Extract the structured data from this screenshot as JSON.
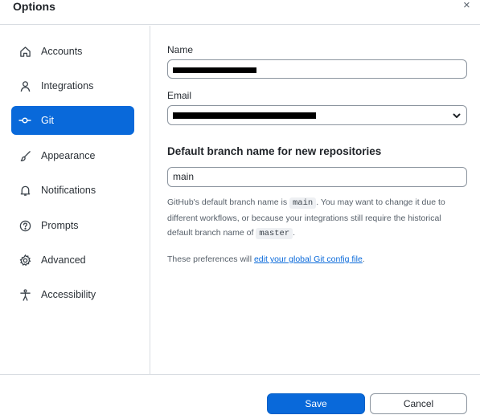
{
  "window": {
    "title": "Options",
    "close_glyph": "×"
  },
  "sidebar": {
    "items": [
      {
        "label": "Accounts",
        "icon": "home-icon",
        "active": false
      },
      {
        "label": "Integrations",
        "icon": "person-icon",
        "active": false
      },
      {
        "label": "Git",
        "icon": "git-commit-icon",
        "active": true
      },
      {
        "label": "Appearance",
        "icon": "paintbrush-icon",
        "active": false
      },
      {
        "label": "Notifications",
        "icon": "bell-icon",
        "active": false
      },
      {
        "label": "Prompts",
        "icon": "question-icon",
        "active": false
      },
      {
        "label": "Advanced",
        "icon": "gear-icon",
        "active": false
      },
      {
        "label": "Accessibility",
        "icon": "accessibility-icon",
        "active": false
      }
    ]
  },
  "git": {
    "name_label": "Name",
    "email_label": "Email",
    "section_heading": "Default branch name for new repositories",
    "branch_value": "main",
    "help": {
      "p1": "GitHub's default branch name is ",
      "code1": "main",
      "p2": ". You may want to change it due to different workflows, or because your integrations still require the historical default branch name of ",
      "code2": "master",
      "p3": "."
    },
    "prefs": {
      "prefix": "These preferences will ",
      "link": "edit your global Git config file",
      "suffix": "."
    }
  },
  "footer": {
    "save_label": "Save",
    "cancel_label": "Cancel"
  },
  "colors": {
    "accent": "#0969da"
  }
}
